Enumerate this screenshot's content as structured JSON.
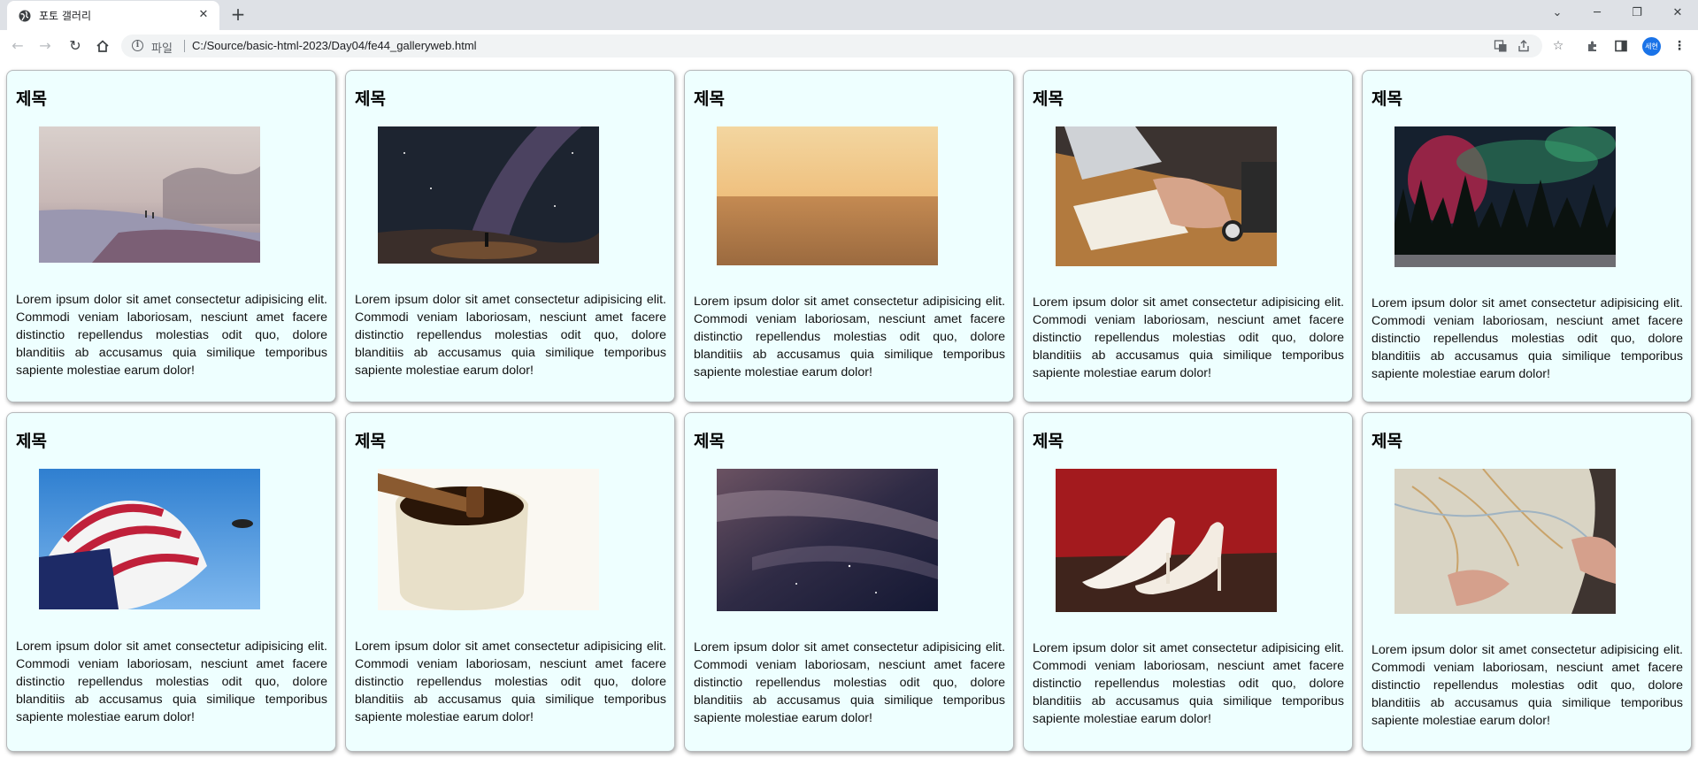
{
  "browser": {
    "tab_title": "포토 갤러리",
    "scheme_label": "파일",
    "url": "C:/Source/basic-html-2023/Day04/fe44_galleryweb.html",
    "avatar_label": "세현"
  },
  "gallery": {
    "cards": [
      {
        "title": "제목",
        "image": "beach-photo",
        "text": "Lorem ipsum dolor sit amet consectetur adipisicing elit. Commodi veniam laboriosam, nesciunt amet facere distinctio repellendus molestias odit quo, dolore blanditiis ab accusamus quia similique temporibus sapiente molestiae earum dolor!"
      },
      {
        "title": "제목",
        "image": "milky-way-photo",
        "text": "Lorem ipsum dolor sit amet consectetur adipisicing elit. Commodi veniam laboriosam, nesciunt amet facere distinctio repellendus molestias odit quo, dolore blanditiis ab accusamus quia similique temporibus sapiente molestiae earum dolor!"
      },
      {
        "title": "제목",
        "image": "desert-photo",
        "text": "Lorem ipsum dolor sit amet consectetur adipisicing elit. Commodi veniam laboriosam, nesciunt amet facere distinctio repellendus molestias odit quo, dolore blanditiis ab accusamus quia similique temporibus sapiente molestiae earum dolor!"
      },
      {
        "title": "제목",
        "image": "laptop-writing-photo",
        "text": "Lorem ipsum dolor sit amet consectetur adipisicing elit. Commodi veniam laboriosam, nesciunt amet facere distinctio repellendus molestias odit quo, dolore blanditiis ab accusamus quia similique temporibus sapiente molestiae earum dolor!"
      },
      {
        "title": "제목",
        "image": "aurora-photo",
        "text": "Lorem ipsum dolor sit amet consectetur adipisicing elit. Commodi veniam laboriosam, nesciunt amet facere distinctio repellendus molestias odit quo, dolore blanditiis ab accusamus quia similique temporibus sapiente molestiae earum dolor!"
      },
      {
        "title": "제목",
        "image": "flag-photo",
        "text": "Lorem ipsum dolor sit amet consectetur adipisicing elit. Commodi veniam laboriosam, nesciunt amet facere distinctio repellendus molestias odit quo, dolore blanditiis ab accusamus quia similique temporibus sapiente molestiae earum dolor!"
      },
      {
        "title": "제목",
        "image": "honey-photo",
        "text": "Lorem ipsum dolor sit amet consectetur adipisicing elit. Commodi veniam laboriosam, nesciunt amet facere distinctio repellendus molestias odit quo, dolore blanditiis ab accusamus quia similique temporibus sapiente molestiae earum dolor!"
      },
      {
        "title": "제목",
        "image": "night-sky-photo",
        "text": "Lorem ipsum dolor sit amet consectetur adipisicing elit. Commodi veniam laboriosam, nesciunt amet facere distinctio repellendus molestias odit quo, dolore blanditiis ab accusamus quia similique temporibus sapiente molestiae earum dolor!"
      },
      {
        "title": "제목",
        "image": "white-shoes-photo",
        "text": "Lorem ipsum dolor sit amet consectetur adipisicing elit. Commodi veniam laboriosam, nesciunt amet facere distinctio repellendus molestias odit quo, dolore blanditiis ab accusamus quia similique temporibus sapiente molestiae earum dolor!"
      },
      {
        "title": "제목",
        "image": "map-photo",
        "text": "Lorem ipsum dolor sit amet consectetur adipisicing elit. Commodi veniam laboriosam, nesciunt amet facere distinctio repellendus molestias odit quo, dolore blanditiis ab accusamus quia similique temporibus sapiente molestiae earum dolor!"
      }
    ]
  }
}
